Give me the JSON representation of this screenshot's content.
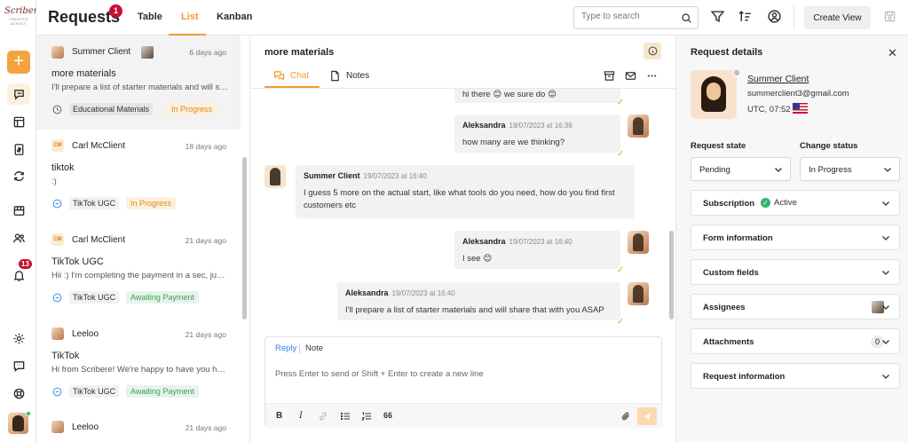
{
  "brand": {
    "logo_text": "Scribere",
    "logo_subtext": "CREATIVE AGENCY",
    "accent": "#f29a33",
    "alert": "#c8102e"
  },
  "rail": {
    "notifications_badge": "13"
  },
  "header": {
    "title": "Requests",
    "title_badge": "1",
    "view_tabs": [
      "Table",
      "List",
      "Kanban"
    ],
    "active_tab": "List",
    "search_placeholder": "Type to search",
    "create_view_label": "Create View"
  },
  "requests": [
    {
      "client": "Summer Client",
      "age": "6 days ago",
      "subject": "more materials",
      "snippet": "I'll prepare a list of starter materials and will share that with you ASAP",
      "category": "Educational Materials",
      "status": "In Progress",
      "status_color": "orange",
      "avatar": "photo",
      "selected": true
    },
    {
      "client": "Carl McClient",
      "age": "18 days ago",
      "subject": "tiktok",
      "snippet": ":)",
      "category": "TikTok UGC",
      "status": "In Progress",
      "status_color": "orange",
      "avatar": "CM",
      "selected": false
    },
    {
      "client": "Carl McClient",
      "age": "21 days ago",
      "subject": "TikTok UGC",
      "snippet": "Hii :) I'm completing the payment in a sec, just one moment",
      "category": "TikTok UGC",
      "status": "Awaiting Payment",
      "status_color": "green",
      "avatar": "CM",
      "selected": false
    },
    {
      "client": "Leeloo",
      "age": "21 days ago",
      "subject": "TikTok",
      "snippet": "Hi from Scribere! We're happy to have you here",
      "category": "TikTok UGC",
      "status": "Awaiting Payment",
      "status_color": "green",
      "avatar": "photo",
      "selected": false
    },
    {
      "client": "Leeloo",
      "age": "21 days ago",
      "subject": "",
      "snippet": "",
      "category": "",
      "status": "",
      "status_color": "",
      "avatar": "photo",
      "selected": false
    }
  ],
  "conversation": {
    "title": "more materials",
    "tabs": [
      "Chat",
      "Notes"
    ],
    "active_tab": "Chat",
    "messages": [
      {
        "author": "",
        "time": "",
        "text": "hi there 😊 we sure do 😊",
        "side": "right"
      },
      {
        "author": "Aleksandra",
        "time": "19/07/2023 at 16:39",
        "text": "how many are we thinking?",
        "side": "right"
      },
      {
        "author": "Summer Client",
        "time": "19/07/2023 at 16:40",
        "text": "I guess 5 more on the actual start, like what tools do you need, how do you find first customers etc",
        "side": "left"
      },
      {
        "author": "Aleksandra",
        "time": "19/07/2023 at 16:40",
        "text": "I see 😊",
        "side": "right"
      },
      {
        "author": "Aleksandra",
        "time": "19/07/2023 at 16:40",
        "text": "I'll prepare a list of starter materials and will share that with you ASAP",
        "side": "right"
      }
    ],
    "composer": {
      "modes": [
        "Reply",
        "Note"
      ],
      "active_mode": "Reply",
      "placeholder": "Press Enter to send or Shift + Enter to create a new line",
      "tools": [
        "B",
        "I",
        "link",
        "bulleted-list",
        "numbered-list",
        "66"
      ]
    }
  },
  "details": {
    "title": "Request details",
    "client_name": "Summer Client",
    "client_email": "summerclient3@gmail.com",
    "client_time": "UTC, 07:52",
    "request_state_label": "Request state",
    "request_state_value": "Pending",
    "change_status_label": "Change status",
    "change_status_value": "In Progress",
    "sections": [
      {
        "title": "Subscription",
        "extra": "Active"
      },
      {
        "title": "Form information",
        "extra": ""
      },
      {
        "title": "Custom fields",
        "extra": ""
      },
      {
        "title": "Assignees",
        "extra": ""
      },
      {
        "title": "Attachments",
        "extra": "0"
      },
      {
        "title": "Request information",
        "extra": ""
      }
    ]
  }
}
